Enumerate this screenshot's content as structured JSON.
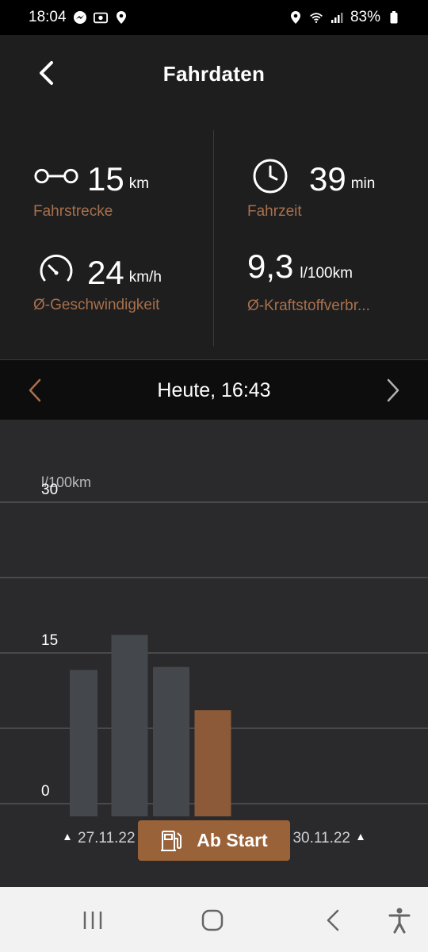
{
  "status_bar": {
    "time": "18:04",
    "left_icons": [
      "messenger-icon",
      "photo-icon",
      "location-icon"
    ],
    "right_icons": [
      "location-icon",
      "wifi-icon",
      "signal-icon"
    ],
    "battery": "83%"
  },
  "header": {
    "title": "Fahrdaten"
  },
  "stats": {
    "distance": {
      "value": "15",
      "unit": "km",
      "label": "Fahrstrecke"
    },
    "duration": {
      "value": "39",
      "unit": "min",
      "label": "Fahrzeit"
    },
    "speed": {
      "value": "24",
      "unit": "km/h",
      "label": "Ø-Geschwindigkeit"
    },
    "consumption": {
      "value": "9,3",
      "unit": "l/100km",
      "label": "Ø-Kraftstoffverbr..."
    }
  },
  "date_nav": {
    "label": "Heute, 16:43"
  },
  "chart_data": {
    "type": "bar",
    "ylabel": "l/100km",
    "ylim": [
      0,
      30
    ],
    "yticks": [
      "30",
      "15",
      "0"
    ],
    "x_start_label": "27.11.22",
    "x_end_label": "30.11.22",
    "values": [
      13.3,
      16.8,
      13.6,
      9.3
    ],
    "highlight_index": 3,
    "colors": {
      "bar": "#44474c",
      "highlight": "#8c5a38",
      "grid": "#5c5c60"
    }
  },
  "start_button": {
    "label": "Ab Start"
  },
  "colors": {
    "accent": "#a8704c",
    "background": "#1e1e1f"
  }
}
